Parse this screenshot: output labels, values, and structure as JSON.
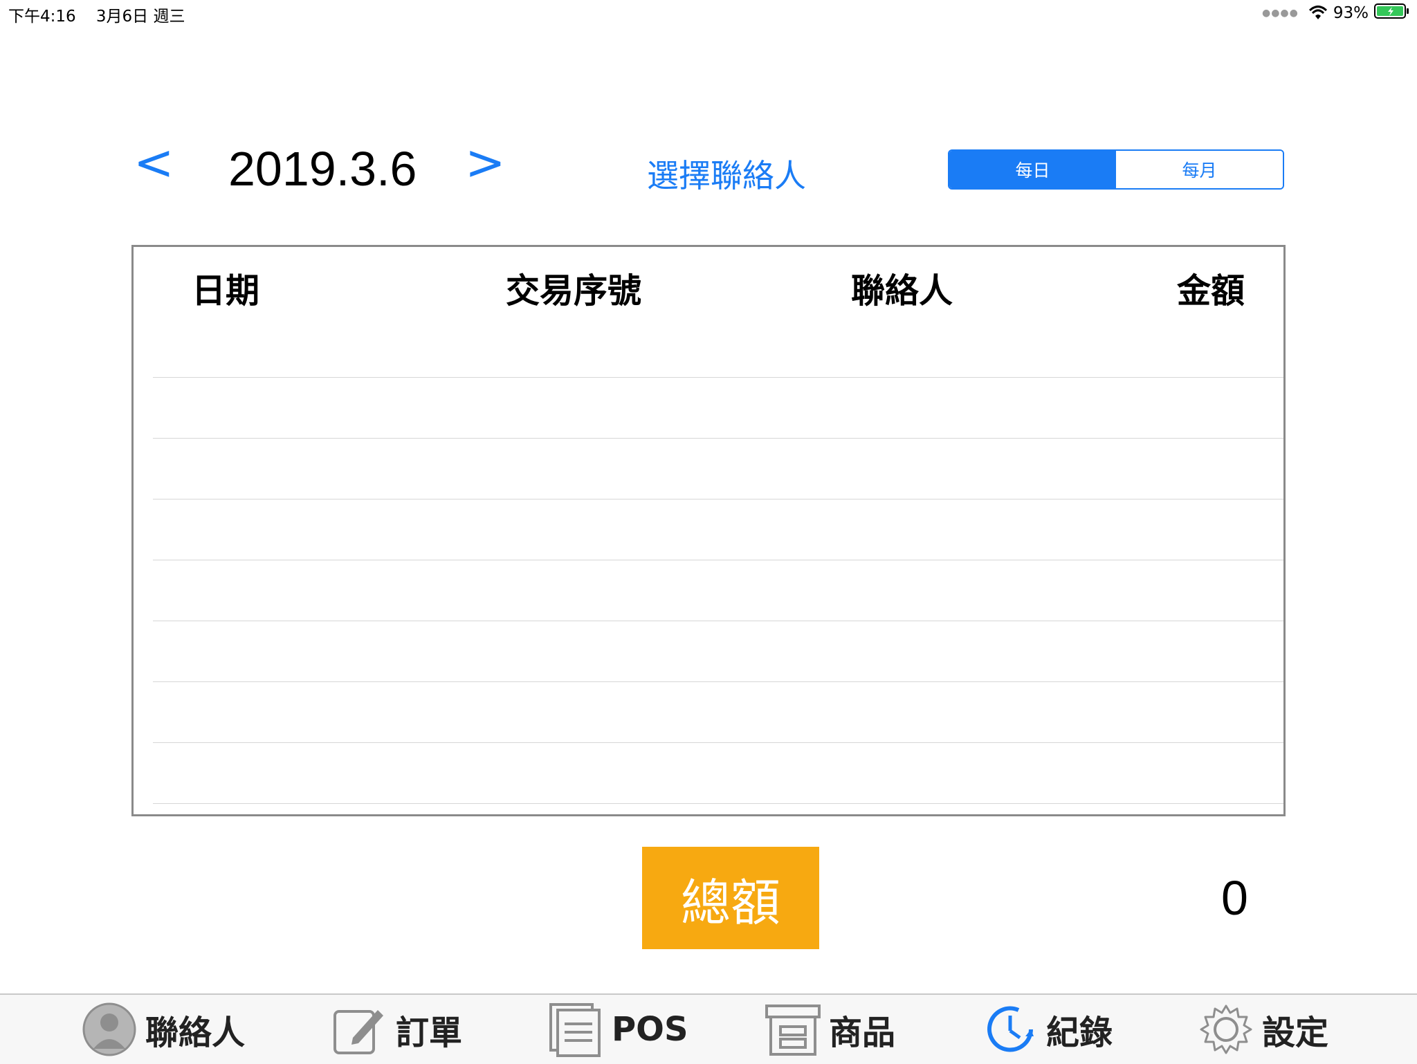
{
  "status_bar": {
    "time": "下午4:16",
    "date": "3月6日 週三",
    "battery": "93%"
  },
  "header": {
    "prev_label": "<",
    "next_label": ">",
    "date": "2019.3.6",
    "select_contact": "選擇聯絡人"
  },
  "segment": {
    "daily": "每日",
    "monthly": "每月",
    "selected": "每日"
  },
  "table": {
    "columns": [
      "日期",
      "交易序號",
      "聯絡人",
      "金額"
    ],
    "rows": []
  },
  "summary": {
    "total_label": "總額",
    "total_value": "0"
  },
  "tabs": [
    {
      "label": "聯絡人",
      "icon": "person-icon"
    },
    {
      "label": "訂單",
      "icon": "edit-icon"
    },
    {
      "label": "POS",
      "icon": "document-icon"
    },
    {
      "label": "商品",
      "icon": "archive-box-icon"
    },
    {
      "label": "紀錄",
      "icon": "history-clock-icon"
    },
    {
      "label": "設定",
      "icon": "gear-icon"
    }
  ],
  "colors": {
    "accent": "#1a7cf5",
    "total_button": "#f7a911",
    "tab_active": "#1a7cf5",
    "tab_icon": "#8e8e8e"
  }
}
